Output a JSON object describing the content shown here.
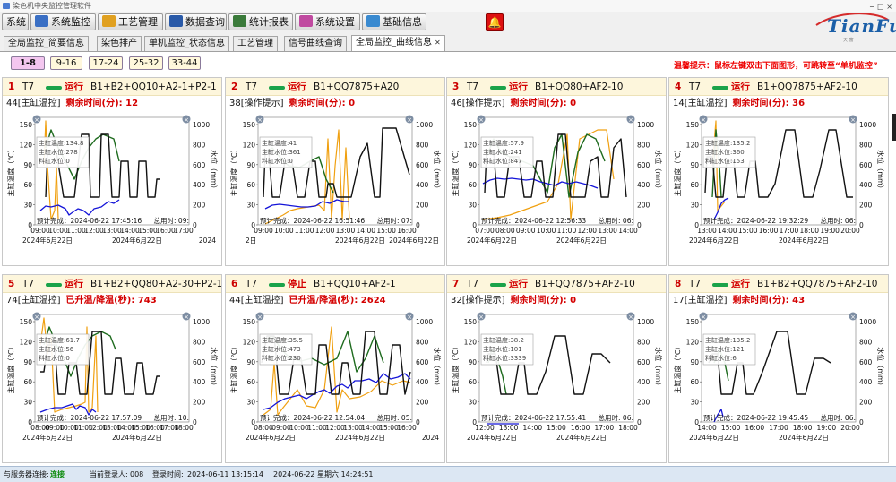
{
  "window": {
    "title": "染色机中央监控管理软件",
    "controls": "− □ ×"
  },
  "menu": [
    {
      "label": "系统",
      "icon": "none"
    },
    {
      "label": "系统监控",
      "icon": "monitor-icon",
      "color": "#3a6fc4"
    },
    {
      "label": "工艺管理",
      "icon": "gear-icon",
      "color": "#e0a020"
    },
    {
      "label": "数据查询",
      "icon": "data-icon",
      "color": "#2a5aa8"
    },
    {
      "label": "统计报表",
      "icon": "report-icon",
      "color": "#3a7a3a"
    },
    {
      "label": "系统设置",
      "icon": "settings-icon",
      "color": "#c04aa0"
    },
    {
      "label": "基础信息",
      "icon": "globe-icon",
      "color": "#3a8ad0"
    }
  ],
  "alarm_icon": "bell-icon",
  "logo": {
    "text": "TianFu",
    "sub": "天  富"
  },
  "tabs": [
    {
      "label": "全局监控_简要信息",
      "active": false
    },
    {
      "label": "染色排产",
      "active": false
    },
    {
      "label": "单机监控_状态信息",
      "active": false
    },
    {
      "label": "工艺管理",
      "active": false
    },
    {
      "label": "信号曲线查询",
      "active": false
    },
    {
      "label": "全局监控_曲线信息",
      "active": true,
      "close": "✕"
    }
  ],
  "pages": [
    "1-8",
    "9-16",
    "17-24",
    "25-32",
    "33-44"
  ],
  "tip": "温馨提示：鼠标左键双击下面图形，可跳转至“单机监控”",
  "chart_labels": {
    "ylabel_left": "主缸温度（℃）",
    "ylabel_right": "水位（mm）",
    "yticks_left": [
      "150",
      "120",
      "90",
      "60",
      "30",
      "0"
    ],
    "yticks_right": [
      "1000",
      "800",
      "600",
      "400",
      "200",
      "0"
    ]
  },
  "panels": [
    {
      "num": "1",
      "machine": "T7",
      "status": "运行",
      "process": "B1+B2+QQ10+A2-1+P2-1",
      "mode": "44[主缸温控]",
      "desc": "剩余时间(分): 12",
      "tooltip": [
        "主缸温度:134.8",
        "主缸水位:278",
        "料缸水位:0"
      ],
      "xticks": [
        "09:00",
        "10:00",
        "11:00",
        "12:00",
        "13:00",
        "14:00",
        "15:00",
        "16:00",
        "17:00"
      ],
      "est": "预计完成：2024-06-22 17:45:16",
      "total": "总用时: 09:",
      "date": "2024年6月22日",
      "date2": "2024年6月22日",
      "tail": "2024"
    },
    {
      "num": "2",
      "machine": "T7",
      "status": "运行",
      "process": "B1+QQ7875+A20",
      "mode": "38[操作提示]",
      "desc": "剩余时间(分): 0",
      "tooltip": [
        "主缸温度:41",
        "主缸水位:361",
        "料缸水位:0"
      ],
      "xticks": [
        "09:00",
        "10:00",
        "11:00",
        "12:00",
        "13:00",
        "14:00",
        "15:00",
        "16:00"
      ],
      "est": "预计完成：2024-06-22 16:51:46",
      "total": "总用时: 07:",
      "date": "2日",
      "date2": "2024年6月22日",
      "tail": "2024年6月22日"
    },
    {
      "num": "3",
      "machine": "T7",
      "status": "运行",
      "process": "B1+QQ80+AF2-10",
      "mode": "46[操作提示]",
      "desc": "剩余时间(分): 0",
      "tooltip": [
        "主缸温度:57.9",
        "主缸水位:241",
        "料缸水位:847"
      ],
      "xticks": [
        "07:00",
        "08:00",
        "09:00",
        "10:00",
        "11:00",
        "12:00",
        "13:00",
        "14:00"
      ],
      "est": "预计完成：2024-06-22 12:56:33",
      "total": "总用时: 06:",
      "date": "2024年6月22日",
      "date2": "2024年6月22日",
      "tail": ""
    },
    {
      "num": "4",
      "machine": "T7",
      "status": "运行",
      "process": "B1+QQ7875+AF2-10",
      "mode": "14[主缸温控]",
      "desc": "剩余时间(分): 36",
      "tooltip": [
        "主缸温度:135.2",
        "主缸水位:360",
        "料缸水位:153"
      ],
      "xticks": [
        "13:00",
        "14:00",
        "15:00",
        "16:00",
        "17:00",
        "18:00",
        "19:00",
        "20:00"
      ],
      "est": "预计完成：2024-06-22 19:32:29",
      "total": "总用时: 06:",
      "date": "2024年6月22日",
      "date2": "2024年6月22日",
      "tail": ""
    },
    {
      "num": "5",
      "machine": "T7",
      "status": "运行",
      "process": "B1+B2+QQ80+A2-30+P2-1",
      "mode": "74[主缸温控]",
      "desc": "已升温/降温(秒): 743",
      "tooltip": [
        "主缸温度:61.7",
        "主缸水位:56",
        "料缸水位:0"
      ],
      "xticks": [
        "08:00",
        "09:00",
        "10:00",
        "11:00",
        "12:00",
        "13:00",
        "14:00",
        "15:00",
        "16:00",
        "17:00",
        "18:00"
      ],
      "est": "预计完成：2024-06-22 17:57:09",
      "total": "总用时: 10:",
      "date": "2024年6月22日",
      "date2": "2024年6月22日",
      "tail": ""
    },
    {
      "num": "6",
      "machine": "T7",
      "status": "停止",
      "process": "B1+QQ10+AF2-1",
      "mode": "44[主缸温控]",
      "desc": "已升温/降温(秒): 2624",
      "tooltip": [
        "主缸温度:35.5",
        "主缸水位:473",
        "料缸水位:230"
      ],
      "xticks": [
        "08:00",
        "09:00",
        "10:00",
        "11:00",
        "12:00",
        "13:00",
        "14:00",
        "15:00",
        "16:00"
      ],
      "est": "预计完成：2024-06-22 12:54:04",
      "total": "总用时: 05:",
      "date": "2024年6月22日",
      "date2": "2024年6月22日",
      "tail": "2024"
    },
    {
      "num": "7",
      "machine": "T7",
      "status": "运行",
      "process": "B1+QQ7875+AF2-10",
      "mode": "32[操作提示]",
      "desc": "剩余时间(分): 0",
      "tooltip": [
        "主缸温度:38.2",
        "主缸水位:101",
        "料缸水位:3339"
      ],
      "xticks": [
        "12:00",
        "13:00",
        "14:00",
        "15:00",
        "16:00",
        "17:00",
        "18:00"
      ],
      "est": "预计完成：2024-06-22 17:55:41",
      "total": "总用时: 06:",
      "date": "2024年6月22日",
      "date2": "2024年6月22日",
      "tail": ""
    },
    {
      "num": "8",
      "machine": "T7",
      "status": "运行",
      "process": "B1+B2+QQ7875+AF2-10",
      "mode": "17[主缸温控]",
      "desc": "剩余时间(分): 43",
      "tooltip": [
        "主缸温度:135.2",
        "主缸水位:121",
        "料缸水位:6"
      ],
      "xticks": [
        "14:00",
        "15:00",
        "16:00",
        "17:00",
        "18:00",
        "19:00",
        "20:00"
      ],
      "est": "预计完成：2024-06-22 19:45:45",
      "total": "总用时: 06:",
      "date": "2024年6月22日",
      "date2": "2024年6月22日",
      "tail": ""
    }
  ],
  "series_colors": {
    "setpoint": "#111111",
    "temperature": "#1e6b1e",
    "main_level": "#1414d8",
    "tank_level": "#f0a010",
    "marker": "#2222aa"
  },
  "statusbar": {
    "server_label": "与服务器连接:",
    "server_value": "连接",
    "login_label": "当前登录人:",
    "login_value": "008",
    "login_time_label": "登录时间:",
    "login_time_value": "2024-06-11  13:15:14",
    "now": "2024-06-22  星期六  14:24:51"
  }
}
